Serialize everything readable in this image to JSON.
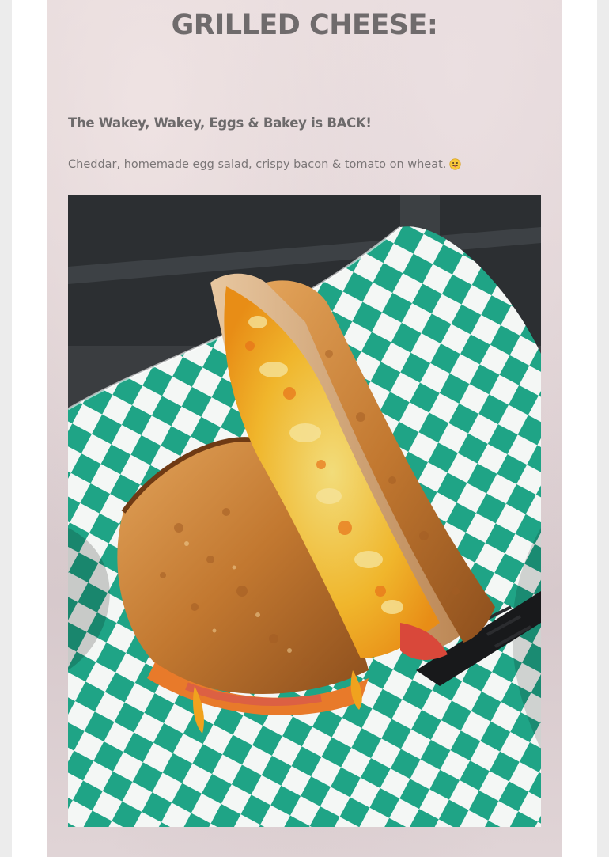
{
  "post": {
    "title": "GRILLED CHEESE:",
    "subtitle": "The Wakey, Wakey, Eggs & Bakey is BACK!",
    "description": "Cheddar, homemade egg salad, crispy bacon & tomato on wheat.",
    "emoji_icon": "face-with-tongue-icon"
  },
  "photo": {
    "subject": "grilled-cheese-sandwich-in-basket",
    "colors": {
      "checker_green": "#1fa486",
      "paper_white": "#f4f7f5",
      "toast": "#c9803a",
      "cheese": "#f0a21e",
      "egg": "#e8d572",
      "basket": "#1e1f22",
      "table": "#3a3d40"
    }
  }
}
